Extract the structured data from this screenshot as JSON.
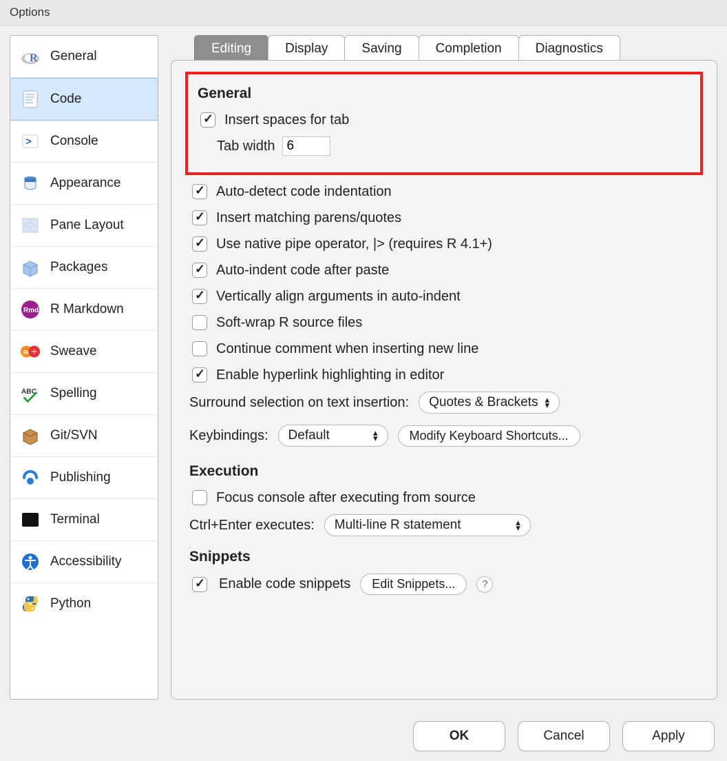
{
  "window_title": "Options",
  "sidebar": {
    "items": [
      {
        "label": "General"
      },
      {
        "label": "Code"
      },
      {
        "label": "Console"
      },
      {
        "label": "Appearance"
      },
      {
        "label": "Pane Layout"
      },
      {
        "label": "Packages"
      },
      {
        "label": "R Markdown"
      },
      {
        "label": "Sweave"
      },
      {
        "label": "Spelling"
      },
      {
        "label": "Git/SVN"
      },
      {
        "label": "Publishing"
      },
      {
        "label": "Terminal"
      },
      {
        "label": "Accessibility"
      },
      {
        "label": "Python"
      }
    ],
    "selected_index": 1
  },
  "tabs": {
    "items": [
      "Editing",
      "Display",
      "Saving",
      "Completion",
      "Diagnostics"
    ],
    "active_index": 0
  },
  "editing": {
    "general_heading": "General",
    "insert_spaces_label": "Insert spaces for tab",
    "insert_spaces_checked": true,
    "tab_width_label": "Tab width",
    "tab_width_value": "6",
    "auto_detect_label": "Auto-detect code indentation",
    "auto_detect_checked": true,
    "match_parens_label": "Insert matching parens/quotes",
    "match_parens_checked": true,
    "native_pipe_label": "Use native pipe operator, |> (requires R 4.1+)",
    "native_pipe_checked": true,
    "auto_indent_paste_label": "Auto-indent code after paste",
    "auto_indent_paste_checked": true,
    "valign_label": "Vertically align arguments in auto-indent",
    "valign_checked": true,
    "softwrap_label": "Soft-wrap R source files",
    "softwrap_checked": false,
    "continue_comment_label": "Continue comment when inserting new line",
    "continue_comment_checked": false,
    "hyperlink_label": "Enable hyperlink highlighting in editor",
    "hyperlink_checked": true,
    "surround_label": "Surround selection on text insertion:",
    "surround_value": "Quotes & Brackets",
    "keybindings_label": "Keybindings:",
    "keybindings_value": "Default",
    "modify_shortcuts_label": "Modify Keyboard Shortcuts...",
    "execution_heading": "Execution",
    "focus_console_label": "Focus console after executing from source",
    "focus_console_checked": false,
    "ctrl_enter_label": "Ctrl+Enter executes:",
    "ctrl_enter_value": "Multi-line R statement",
    "snippets_heading": "Snippets",
    "enable_snippets_label": "Enable code snippets",
    "enable_snippets_checked": true,
    "edit_snippets_label": "Edit Snippets...",
    "help_text": "?"
  },
  "footer": {
    "ok": "OK",
    "cancel": "Cancel",
    "apply": "Apply"
  }
}
